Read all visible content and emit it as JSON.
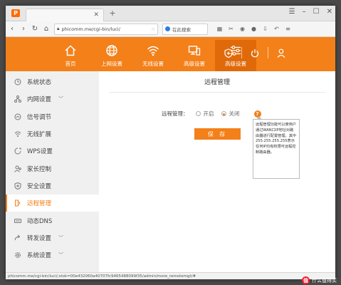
{
  "browser": {
    "tab_badge": "P",
    "tab_label": "",
    "new_tab": "+",
    "address": "phicomm.me/cgi-bin/luci/",
    "search_placeholder": "在此搜索",
    "status_url": "phicomm.me/cgi-bin/luci/;stok=00e432060a40707fc9465488099f35/admin/more_remotemgt/#"
  },
  "header": {
    "nav": [
      {
        "label": "首页",
        "icon": "home-icon"
      },
      {
        "label": "上网设置",
        "icon": "globe-icon"
      },
      {
        "label": "无线设置",
        "icon": "wifi-icon"
      },
      {
        "label": "高级设置",
        "icon": "devices-icon"
      },
      {
        "label": "高级设置",
        "icon": "sliders-icon",
        "active": true
      }
    ],
    "right_icons": [
      "shield-plus-icon",
      "power-icon",
      "user-icon"
    ]
  },
  "sidebar": {
    "items": [
      {
        "label": "系统状态",
        "icon": "status-icon"
      },
      {
        "label": "内网设置",
        "icon": "network-icon",
        "expandable": true
      },
      {
        "label": "信号调节",
        "icon": "signal-icon"
      },
      {
        "label": "无线扩展",
        "icon": "wifi-extend-icon"
      },
      {
        "label": "WPS设置",
        "icon": "wps-icon"
      },
      {
        "label": "家长控制",
        "icon": "parental-icon"
      },
      {
        "label": "安全设置",
        "icon": "security-icon"
      },
      {
        "label": "远程管理",
        "icon": "remote-icon",
        "active": true
      },
      {
        "label": "动态DNS",
        "icon": "dns-icon"
      },
      {
        "label": "转发设置",
        "icon": "forward-icon",
        "expandable": true
      },
      {
        "label": "系统设置",
        "icon": "system-icon",
        "expandable": true
      }
    ]
  },
  "main": {
    "title": "远程管理",
    "field_label": "远程管理：",
    "option_on": "开启",
    "option_off": "关闭",
    "selected": "关闭",
    "help": "?",
    "save_label": "保 存",
    "tooltip": "远程管理功能可以使用户通过WAN口IP地址对路由器进行配置管理。其中255.255.255.255表示任何IP均有权限可远程控制路由器。"
  },
  "watermark": {
    "logo": "值",
    "text": "什么值得买"
  },
  "colors": {
    "accent": "#f38019",
    "accent_dark": "#e06a0a",
    "sidebar_bg": "#f0f0f0"
  }
}
